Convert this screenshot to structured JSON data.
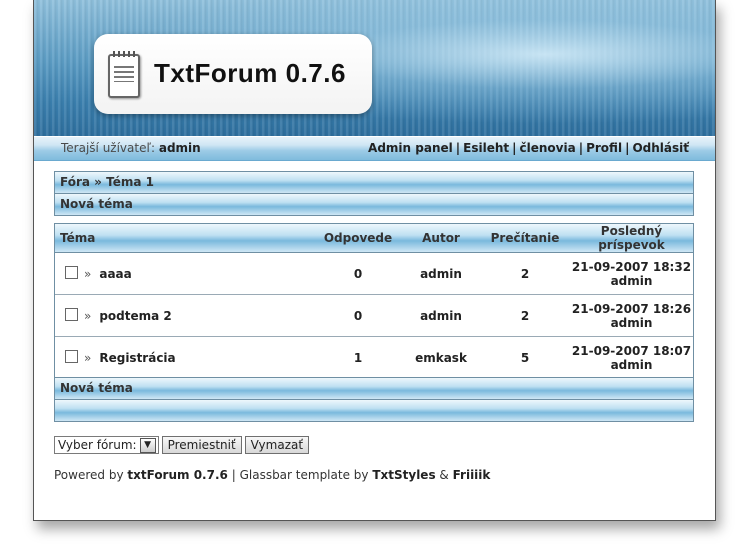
{
  "logo": {
    "title": "TxtForum 0.7.6"
  },
  "userbar": {
    "current_user_label": "Terajší užívateľ:",
    "current_user": "admin",
    "links": [
      "Admin panel",
      "Esileht",
      "členovia",
      "Profil",
      "Odhlásiť"
    ],
    "separator": "|"
  },
  "breadcrumb": {
    "forums": "Fóra",
    "sep": "»",
    "current": "Téma 1"
  },
  "new_topic_label": "Nová téma",
  "table": {
    "headers": [
      "Téma",
      "Odpovede",
      "Autor",
      "Prečítanie",
      "Posledný príspevok"
    ],
    "rows": [
      {
        "title": "aaaa",
        "replies": "0",
        "author": "admin",
        "views": "2",
        "last_date": "21-09-2007 18:32",
        "last_user": "admin"
      },
      {
        "title": "podtema 2",
        "replies": "0",
        "author": "admin",
        "views": "2",
        "last_date": "21-09-2007 18:26",
        "last_user": "admin"
      },
      {
        "title": "Registrácia",
        "replies": "1",
        "author": "emkask",
        "views": "5",
        "last_date": "21-09-2007 18:07",
        "last_user": "admin"
      }
    ],
    "row_arrow": "»"
  },
  "bottom_new_topic_label": "Nová téma",
  "controls": {
    "select_forum": "Vyber fórum:",
    "move_button": "Premiestniť",
    "delete_button": "Vymazať"
  },
  "footer": {
    "powered_by": "Powered by",
    "product": "txtForum 0.7.6",
    "sep": "|",
    "template_text": "Glassbar template by",
    "author1": "TxtStyles",
    "amp": "&",
    "author2": "Friiiik"
  },
  "icons": {
    "logo": "notepad-icon",
    "select_arrow": "chevron-down-icon",
    "checkbox": "checkbox-icon"
  }
}
